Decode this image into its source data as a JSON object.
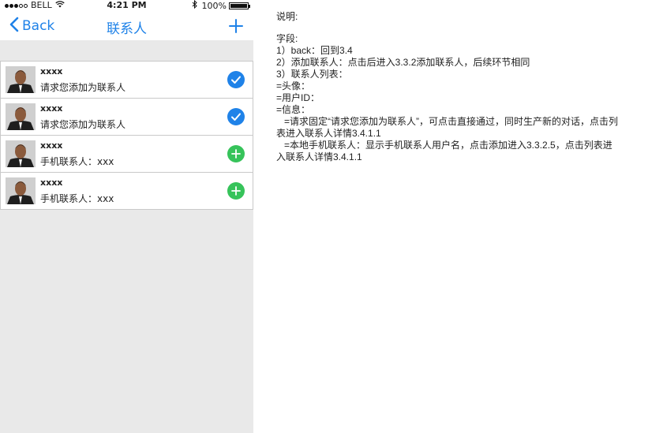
{
  "status_bar": {
    "carrier": "BELL",
    "time": "4:21 PM",
    "battery": "100%"
  },
  "nav": {
    "back_label": "Back",
    "title": "联系人"
  },
  "contacts": [
    {
      "name": "xxxx",
      "message": "请求您添加为联系人",
      "action": "check-icon"
    },
    {
      "name": "xxxx",
      "message": "请求您添加为联系人",
      "action": "check-icon"
    },
    {
      "name": "xxxx",
      "message": "手机联系人：xxx",
      "action": "plus-icon"
    },
    {
      "name": "xxxx",
      "message": "手机联系人：xxx",
      "action": "plus-icon"
    }
  ],
  "notes": {
    "heading": "说明:",
    "fields_heading": "字段:",
    "line1": "1）back：回到3.4",
    "line2": "2）添加联系人：点击后进入3.3.2添加联系人，后续环节相同",
    "line3": "3）联系人列表：",
    "line4": "=头像：",
    "line5": "=用户ID：",
    "line6": "=信息：",
    "line7a": "=请求固定“请求您添加为联系人”，可点击直接通过，同时生产新的对话，点击列",
    "line7b": "表进入联系人详情3.4.1.1",
    "line8a": "=本地手机联系人：显示手机联系人用户名，点击添加进入3.3.2.5，点击列表进",
    "line8b": "入联系人详情3.4.1.1"
  },
  "colors": {
    "accent": "#1f82e8",
    "add_green": "#36c35a",
    "background": "#e9e9e9"
  }
}
